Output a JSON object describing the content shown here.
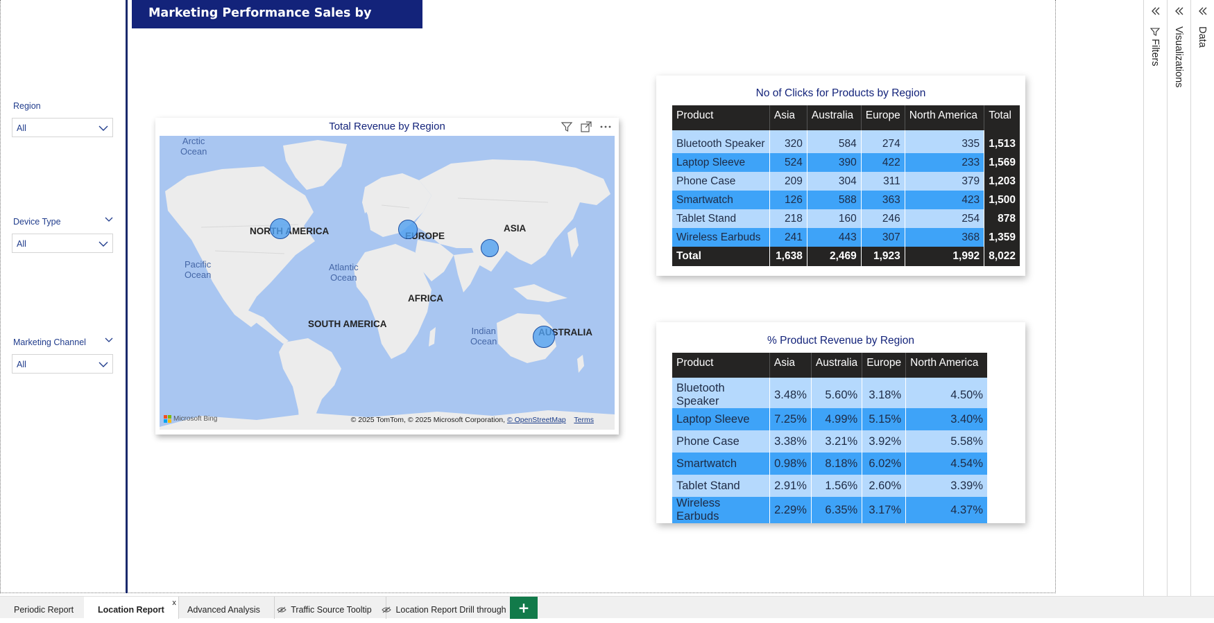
{
  "report": {
    "title": "Marketing Performance Sales by Location"
  },
  "slicers": [
    {
      "label": "Region",
      "value": "All"
    },
    {
      "label": "Device Type",
      "value": "All"
    },
    {
      "label": "Marketing Channel",
      "value": "All"
    }
  ],
  "map": {
    "title": "Total Revenue by Region",
    "land_labels": [
      "NORTH AMERICA",
      "EUROPE",
      "ASIA",
      "AFRICA",
      "SOUTH AMERICA",
      "AUSTRALIA"
    ],
    "ocean_labels": [
      "Arctic\nOcean",
      "Pacific\nOcean",
      "Atlantic\nOcean",
      "Indian\nOcean"
    ],
    "copyright": "© 2025 TomTom, © 2025 Microsoft Corporation,",
    "osm_link": "© OpenStreetMap",
    "terms": "Terms",
    "bing": "Microsoft Bing",
    "bubble_color": "#50a0f0"
  },
  "clicks_table": {
    "title": "No of Clicks for Products by Region",
    "headers": [
      "Product",
      "Asia",
      "Australia",
      "Europe",
      "North America",
      "Total"
    ],
    "rows": [
      [
        "Bluetooth Speaker",
        "320",
        "584",
        "274",
        "335",
        "1,513"
      ],
      [
        "Laptop Sleeve",
        "524",
        "390",
        "422",
        "233",
        "1,569"
      ],
      [
        "Phone Case",
        "209",
        "304",
        "311",
        "379",
        "1,203"
      ],
      [
        "Smartwatch",
        "126",
        "588",
        "363",
        "423",
        "1,500"
      ],
      [
        "Tablet Stand",
        "218",
        "160",
        "246",
        "254",
        "878"
      ],
      [
        "Wireless Earbuds",
        "241",
        "443",
        "307",
        "368",
        "1,359"
      ]
    ],
    "total_row": [
      "Total",
      "1,638",
      "2,469",
      "1,923",
      "1,992",
      "8,022"
    ]
  },
  "pct_table": {
    "title": "% Product Revenue by Region",
    "headers": [
      "Product",
      "Asia",
      "Australia",
      "Europe",
      "North America"
    ],
    "rows": [
      [
        "Bluetooth Speaker",
        "3.48%",
        "5.60%",
        "3.18%",
        "4.50%"
      ],
      [
        "Laptop Sleeve",
        "7.25%",
        "4.99%",
        "5.15%",
        "3.40%"
      ],
      [
        "Phone Case",
        "3.38%",
        "3.21%",
        "3.92%",
        "5.58%"
      ],
      [
        "Smartwatch",
        "0.98%",
        "8.18%",
        "6.02%",
        "4.54%"
      ],
      [
        "Tablet Stand",
        "2.91%",
        "1.56%",
        "2.60%",
        "3.39%"
      ],
      [
        "Wireless Earbuds",
        "2.29%",
        "6.35%",
        "3.17%",
        "4.37%"
      ]
    ]
  },
  "panes": {
    "filters": "Filters",
    "visualizations": "Visualizations",
    "data": "Data"
  },
  "tabs": [
    {
      "label": "Periodic Report",
      "hidden": false
    },
    {
      "label": "Location Report",
      "hidden": false,
      "active": true
    },
    {
      "label": "Advanced Analysis",
      "hidden": false
    },
    {
      "label": "Traffic Source Tooltip",
      "hidden": true
    },
    {
      "label": "Location Report Drill through",
      "hidden": true
    }
  ],
  "tab_close": "x",
  "tab_add": "+",
  "colors": {
    "brand": "#13237a",
    "table_header": "#252423",
    "row_light": "#b5d9fd",
    "row_dark": "#3ea3f8",
    "tab_add": "#127a4a"
  }
}
